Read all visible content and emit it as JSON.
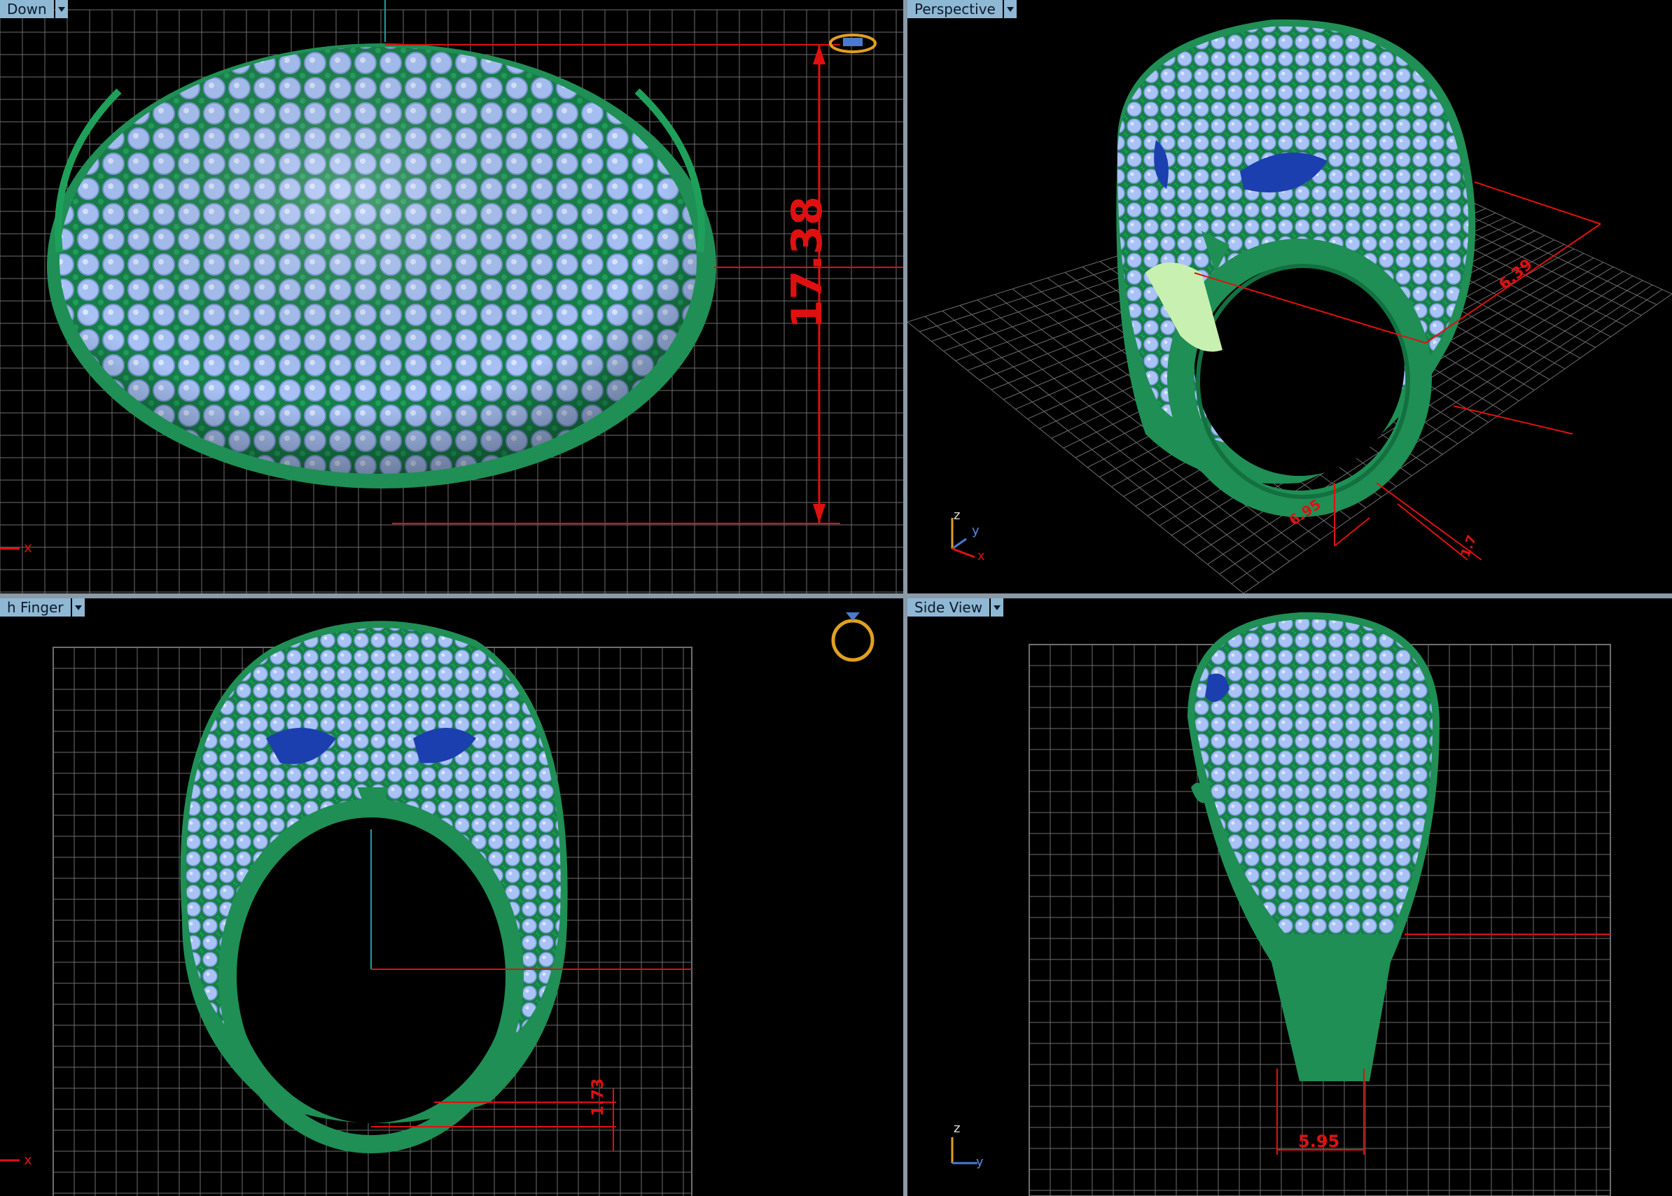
{
  "viewports": {
    "top_left": {
      "title": "Down",
      "dimension": "17.38",
      "axis": "x"
    },
    "top_right": {
      "title": "Perspective",
      "dim_a": "6.95",
      "dim_b": "6.39",
      "dim_c": "1.7",
      "axis_z": "z",
      "axis_y": "y",
      "axis_x": "x"
    },
    "bottom_left": {
      "title": "h Finger",
      "dimension": "1.73",
      "axis": "x"
    },
    "bottom_right": {
      "title": "Side View",
      "dimension": "5.95",
      "axis_z": "z",
      "axis_y": "y"
    }
  },
  "colors": {
    "background": "#000000",
    "grid": "#6e6e6e",
    "metal": "#1f8f55",
    "stone": "#a9c3f7",
    "eye": "#1b3fae",
    "dimension": "#e01010",
    "tab": "#8fb8d4",
    "separator": "#8a9aa8"
  },
  "icons": {
    "top_left_marker": "ring-top-icon",
    "bottom_left_marker": "ring-front-icon"
  }
}
